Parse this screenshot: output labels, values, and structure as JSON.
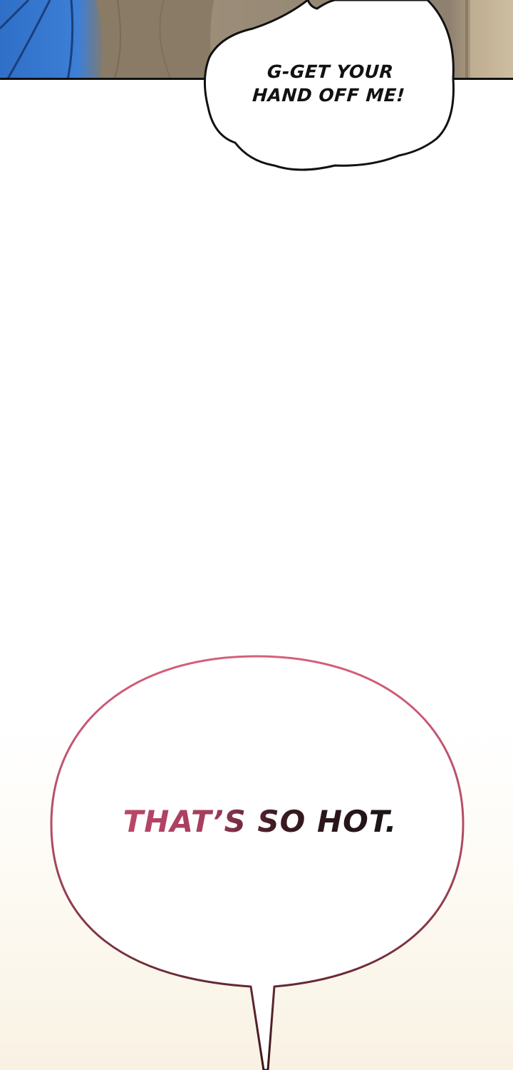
{
  "panels": {
    "top": {
      "description_colors": {
        "shirt": "#3d7fd6",
        "background": "#9b8d78"
      }
    }
  },
  "bubbles": [
    {
      "text": "G-GET YOUR\nHAND OFF ME!",
      "border_color": "#111111"
    },
    {
      "text": "THAT'S SO HOT.",
      "border_gradient": [
        "#d4607c",
        "#3a1518"
      ],
      "text_gradient": [
        "#c24a6d",
        "#111111"
      ]
    }
  ],
  "bubble_1_line_1": "G-GET YOUR",
  "bubble_1_line_2": "HAND OFF ME!",
  "bubble_2_text": "THAT’S SO HOT."
}
